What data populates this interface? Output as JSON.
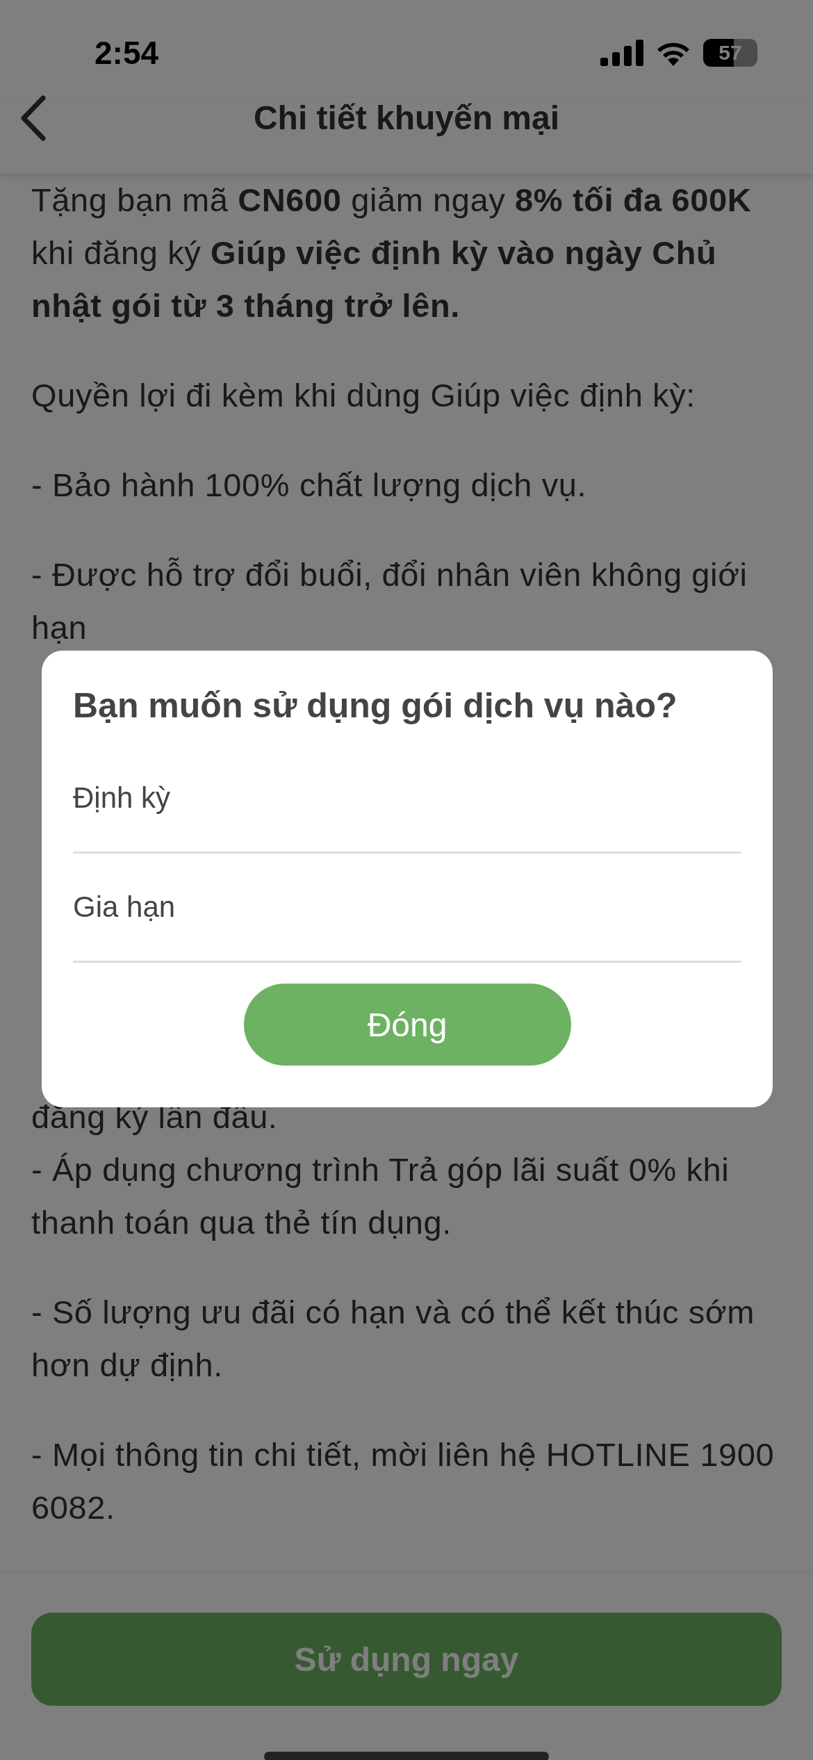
{
  "status_bar": {
    "time": "2:54",
    "battery": "57"
  },
  "header": {
    "title": "Chi tiết khuyến mại"
  },
  "content": {
    "paragraphs": [
      "Tặng bạn mã **CN600** giảm ngay **8% tối đa 600K** khi đăng ký **Giúp việc định kỳ vào ngày Chủ nhật gói từ 3 tháng trở lên.**",
      "Quyền lợi đi kèm khi dùng Giúp việc định kỳ:",
      "- Bảo hành 100% chất lượng dịch vụ.",
      "- Được hỗ trợ đổi buổi, đổi nhân viên không giới hạn"
    ],
    "blocks_below": [
      {
        "lines": [
          "đăng ký lần đầu.",
          "- Áp dụng chương trình Trả góp lãi suất 0% khi thanh toán qua thẻ tín dụng."
        ]
      },
      {
        "lines": [
          "- Số lượng ưu đãi có hạn và có thể kết thúc sớm hơn dự định."
        ]
      },
      {
        "lines": [
          "- Mọi thông tin chi tiết, mời liên hệ HOTLINE 1900 6082."
        ]
      }
    ]
  },
  "footer": {
    "button": "Sử dụng ngay"
  },
  "dialog": {
    "title": "Bạn muốn sử dụng gói dịch vụ nào?",
    "options": [
      "Định kỳ",
      "Gia hạn"
    ],
    "close_button": "Đóng"
  }
}
